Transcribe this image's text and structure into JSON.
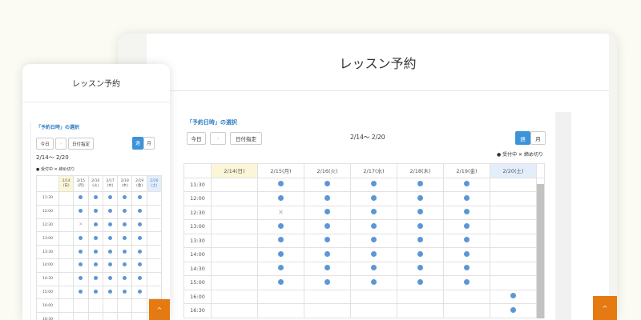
{
  "desktop": {
    "title": "レッスン予約",
    "section_title": "「予約日時」の選択",
    "today_btn": "今日",
    "next_icon": "chevron-right",
    "date_btn": "日付指定",
    "week_btn": "週",
    "month_btn": "月",
    "range": "2/14〜 2/20",
    "legend": "● 受付中 ✕ 締め切り",
    "days": [
      "2/14(日)",
      "2/15(月)",
      "2/16(火)",
      "2/17(水)",
      "2/18(木)",
      "2/19(金)",
      "2/20(土)"
    ],
    "scroll_up": "^"
  },
  "mobile": {
    "title": "レッスン予約",
    "section_title": "「予約日時」の選択",
    "today_btn": "今日",
    "date_btn": "日付指定",
    "week_btn": "週",
    "month_btn": "月",
    "range": "2/14〜 2/20",
    "legend": "● 受付中 ✕ 締め切り",
    "days_top": [
      "2/14",
      "2/15",
      "2/16",
      "2/17",
      "2/18",
      "2/19",
      "2/20"
    ],
    "days_bottom": [
      "(日)",
      "(月)",
      "(火)",
      "(水)",
      "(木)",
      "(金)",
      "(土)"
    ],
    "scroll_up": "^"
  },
  "schedule": {
    "times": [
      "11:30",
      "12:00",
      "12:30",
      "13:00",
      "13:30",
      "14:00",
      "14:30",
      "15:00",
      "16:00",
      "16:30"
    ],
    "slots": [
      [
        "",
        "o",
        "o",
        "o",
        "o",
        "o",
        ""
      ],
      [
        "",
        "o",
        "o",
        "o",
        "o",
        "o",
        ""
      ],
      [
        "",
        "x",
        "o",
        "o",
        "o",
        "o",
        ""
      ],
      [
        "",
        "o",
        "o",
        "o",
        "o",
        "o",
        ""
      ],
      [
        "",
        "o",
        "o",
        "o",
        "o",
        "o",
        ""
      ],
      [
        "",
        "o",
        "o",
        "o",
        "o",
        "o",
        ""
      ],
      [
        "",
        "o",
        "o",
        "o",
        "o",
        "o",
        ""
      ],
      [
        "",
        "o",
        "o",
        "o",
        "o",
        "o",
        ""
      ],
      [
        "",
        "",
        "",
        "",
        "",
        "",
        "o"
      ],
      [
        "",
        "",
        "",
        "",
        "",
        "",
        "o"
      ]
    ]
  },
  "colors": {
    "accent": "#3d93d9",
    "available": "#5d96d6",
    "orange": "#e47a11",
    "today_bg": "#fbf6d8",
    "sat_bg": "#e4eefa"
  }
}
